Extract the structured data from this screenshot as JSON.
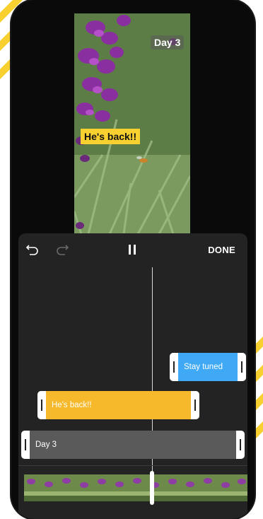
{
  "video": {
    "overlays": {
      "day_label": "Day 3",
      "back_label": "He's back!!"
    }
  },
  "toolbar": {
    "undo_icon": "undo-icon",
    "redo_icon": "redo-icon",
    "pause_icon": "pause-icon",
    "done_label": "DONE"
  },
  "timeline": {
    "clips": [
      {
        "label": "Stay tuned",
        "color": "#3fa9f5"
      },
      {
        "label": "He's back!!",
        "color": "#f6b92b"
      },
      {
        "label": "Day 3",
        "color": "#5a5a5a"
      }
    ]
  },
  "colors": {
    "accent_yellow": "#f8d030",
    "editor_bg": "#232323"
  }
}
